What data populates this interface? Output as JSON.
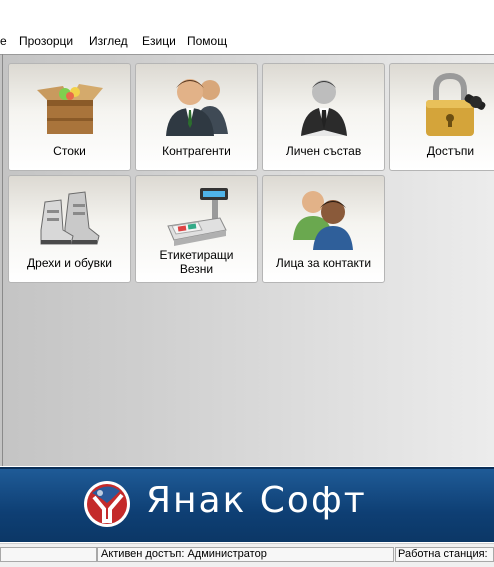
{
  "menubar": {
    "items": [
      {
        "label": "е"
      },
      {
        "label": "Прозорци"
      },
      {
        "label": "Изглед"
      },
      {
        "label": "Езици"
      },
      {
        "label": "Помощ"
      }
    ]
  },
  "tiles": [
    {
      "label": "Стоки",
      "icon": "box-icon"
    },
    {
      "label": "Контрагенти",
      "icon": "people-icon"
    },
    {
      "label": "Личен състав",
      "icon": "person-icon"
    },
    {
      "label": "Достъпи",
      "icon": "lock-icon"
    },
    {
      "label": "Дрехи и обувки",
      "icon": "boots-icon"
    },
    {
      "label1": "Етикетиращи",
      "label2": "Везни",
      "icon": "scale-icon"
    },
    {
      "label": "Лица за контакти",
      "icon": "contacts-icon"
    }
  ],
  "banner": {
    "brand": "Янак Софт"
  },
  "statusbar": {
    "active_access": "Активен достъп: Администратор",
    "workstation": "Работна станция: "
  }
}
